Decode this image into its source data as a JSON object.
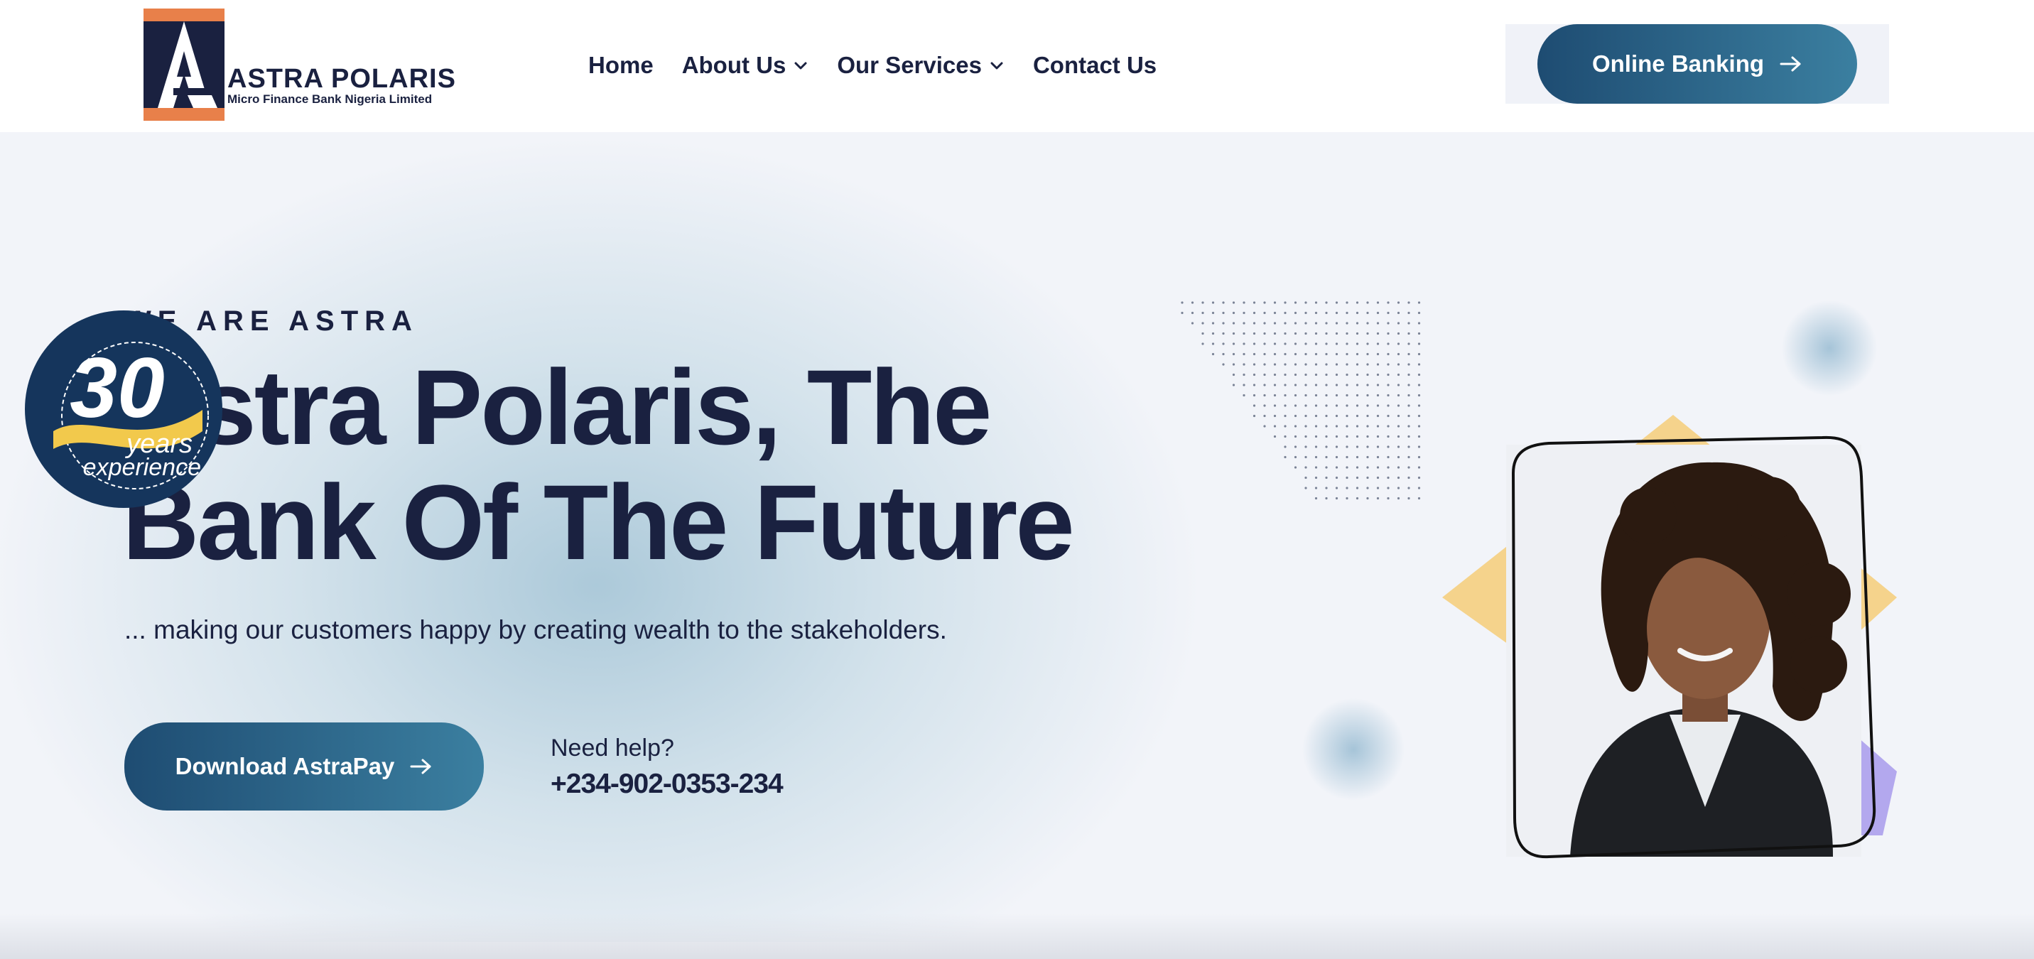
{
  "header": {
    "logo": {
      "name": "ASTRA POLARIS",
      "subtitle": "Micro Finance Bank Nigeria Limited"
    },
    "nav": [
      {
        "label": "Home",
        "has_dropdown": false
      },
      {
        "label": "About Us",
        "has_dropdown": true
      },
      {
        "label": "Our Services",
        "has_dropdown": true
      },
      {
        "label": "Contact Us",
        "has_dropdown": false
      }
    ],
    "cta_label": "Online Banking"
  },
  "hero": {
    "eyebrow": "WE ARE ASTRA",
    "headline": "Astra Polaris, The Bank Of The Future",
    "tagline": "... making our customers happy by creating wealth to the stakeholders.",
    "download_label": "Download AstraPay",
    "help_label": "Need help?",
    "help_phone": "+234-902-0353-234",
    "badge": {
      "number": "30",
      "line1": "years",
      "line2": "experience"
    }
  },
  "colors": {
    "navy": "#1a2140",
    "button_gradient_start": "#1e4c72",
    "button_gradient_end": "#3b7fa0",
    "logo_orange": "#e8804a",
    "diamond_yellow": "#f5d38c",
    "shape_purple": "#b3a8ee",
    "page_bg": "#f2f4f9"
  },
  "icons": {
    "chevron": "chevron-down-icon",
    "arrow": "arrow-right-icon"
  }
}
